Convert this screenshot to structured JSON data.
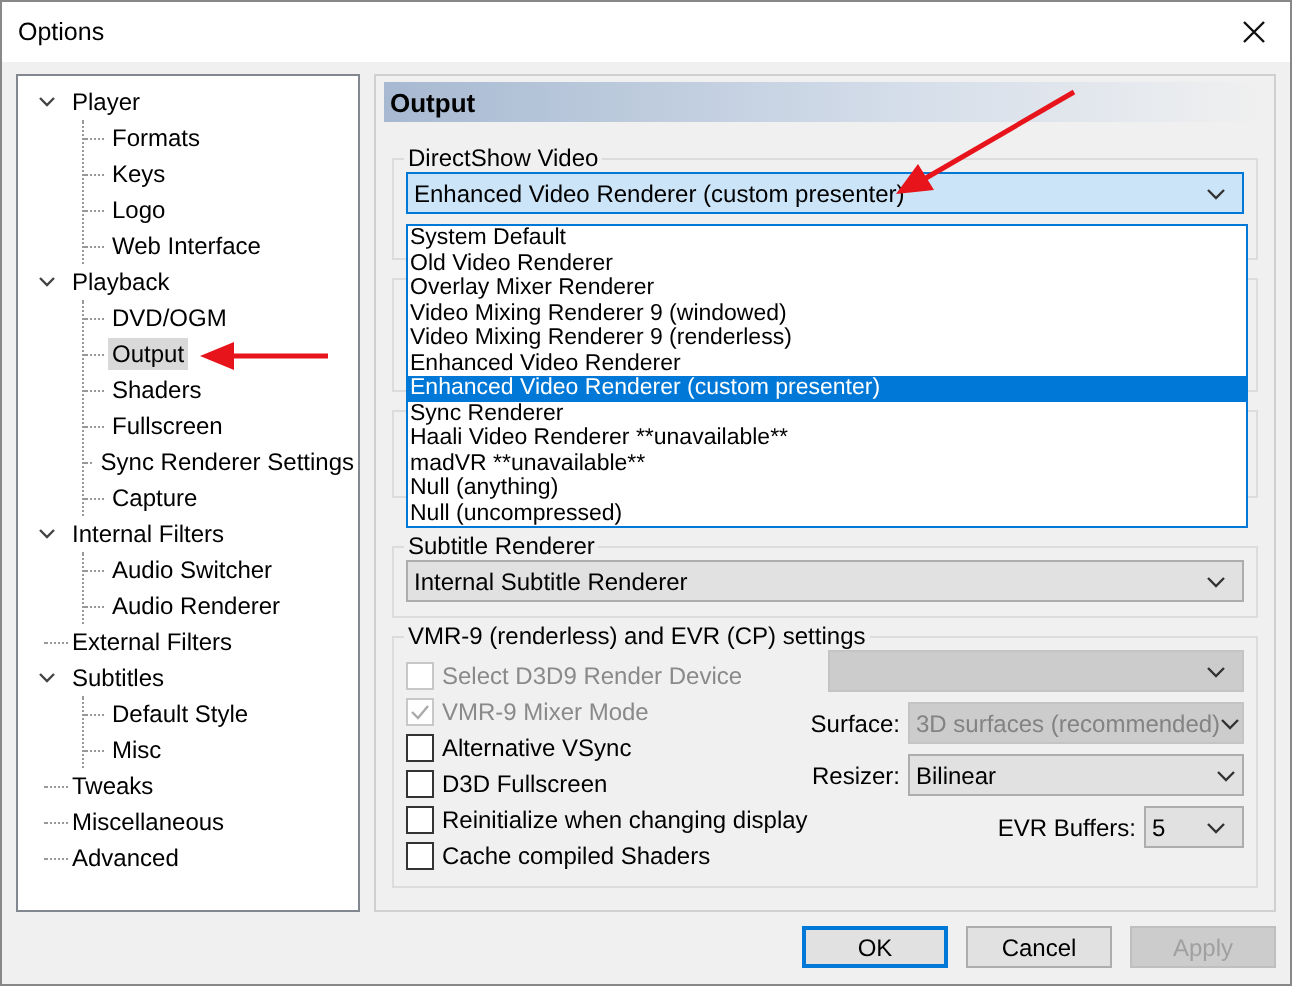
{
  "window": {
    "title": "Options"
  },
  "tree": [
    {
      "label": "Player",
      "expanded": true,
      "selected": false,
      "children": [
        {
          "label": "Formats",
          "selected": false
        },
        {
          "label": "Keys",
          "selected": false
        },
        {
          "label": "Logo",
          "selected": false
        },
        {
          "label": "Web Interface",
          "selected": false
        }
      ]
    },
    {
      "label": "Playback",
      "expanded": true,
      "selected": false,
      "children": [
        {
          "label": "DVD/OGM",
          "selected": false
        },
        {
          "label": "Output",
          "selected": true
        },
        {
          "label": "Shaders",
          "selected": false
        },
        {
          "label": "Fullscreen",
          "selected": false
        },
        {
          "label": "Sync Renderer Settings",
          "selected": false
        },
        {
          "label": "Capture",
          "selected": false
        }
      ]
    },
    {
      "label": "Internal Filters",
      "expanded": true,
      "selected": false,
      "children": [
        {
          "label": "Audio Switcher",
          "selected": false
        },
        {
          "label": "Audio Renderer",
          "selected": false
        }
      ]
    },
    {
      "label": "External Filters",
      "selected": false
    },
    {
      "label": "Subtitles",
      "expanded": true,
      "selected": false,
      "children": [
        {
          "label": "Default Style",
          "selected": false
        },
        {
          "label": "Misc",
          "selected": false
        }
      ]
    },
    {
      "label": "Tweaks",
      "selected": false
    },
    {
      "label": "Miscellaneous",
      "selected": false
    },
    {
      "label": "Advanced",
      "selected": false
    }
  ],
  "page": {
    "title": "Output",
    "directshow_video": {
      "label": "DirectShow Video",
      "value": "Enhanced Video Renderer (custom presenter)",
      "expanded": true,
      "options": [
        {
          "label": "System Default",
          "selected": false
        },
        {
          "label": "Old Video Renderer",
          "selected": false
        },
        {
          "label": "Overlay Mixer Renderer",
          "selected": false
        },
        {
          "label": "Video Mixing Renderer 9 (windowed)",
          "selected": false
        },
        {
          "label": "Video Mixing Renderer 9 (renderless)",
          "selected": false
        },
        {
          "label": "Enhanced Video Renderer",
          "selected": false
        },
        {
          "label": "Enhanced Video Renderer (custom presenter)",
          "selected": true
        },
        {
          "label": "Sync Renderer",
          "selected": false
        },
        {
          "label": "Haali Video Renderer **unavailable**",
          "selected": false
        },
        {
          "label": "madVR **unavailable**",
          "selected": false
        },
        {
          "label": "Null (anything)",
          "selected": false
        },
        {
          "label": "Null (uncompressed)",
          "selected": false
        }
      ]
    },
    "subtitle_renderer": {
      "label": "Subtitle Renderer",
      "value": "Internal Subtitle Renderer"
    },
    "vmr_settings": {
      "title": "VMR-9 (renderless) and EVR (CP) settings",
      "checkboxes": [
        {
          "label": "Select D3D9 Render Device",
          "checked": false,
          "disabled": true
        },
        {
          "label": "VMR-9 Mixer Mode",
          "checked": true,
          "disabled": true
        },
        {
          "label": "Alternative VSync",
          "checked": false,
          "disabled": false
        },
        {
          "label": "D3D Fullscreen",
          "checked": false,
          "disabled": false
        },
        {
          "label": "Reinitialize when changing display",
          "checked": false,
          "disabled": false
        },
        {
          "label": "Cache compiled Shaders",
          "checked": false,
          "disabled": false
        }
      ],
      "render_device": {
        "disabled": true
      },
      "surface": {
        "label": "Surface:",
        "value": "3D surfaces (recommended)",
        "disabled": true
      },
      "resizer": {
        "label": "Resizer:",
        "value": "Bilinear",
        "disabled": false
      },
      "evr_buffers": {
        "label": "EVR Buffers:",
        "value": "5",
        "disabled": false
      }
    }
  },
  "buttons": [
    {
      "label": "OK",
      "default": true,
      "disabled": false
    },
    {
      "label": "Cancel",
      "default": false,
      "disabled": false
    },
    {
      "label": "Apply",
      "default": false,
      "disabled": true
    }
  ]
}
